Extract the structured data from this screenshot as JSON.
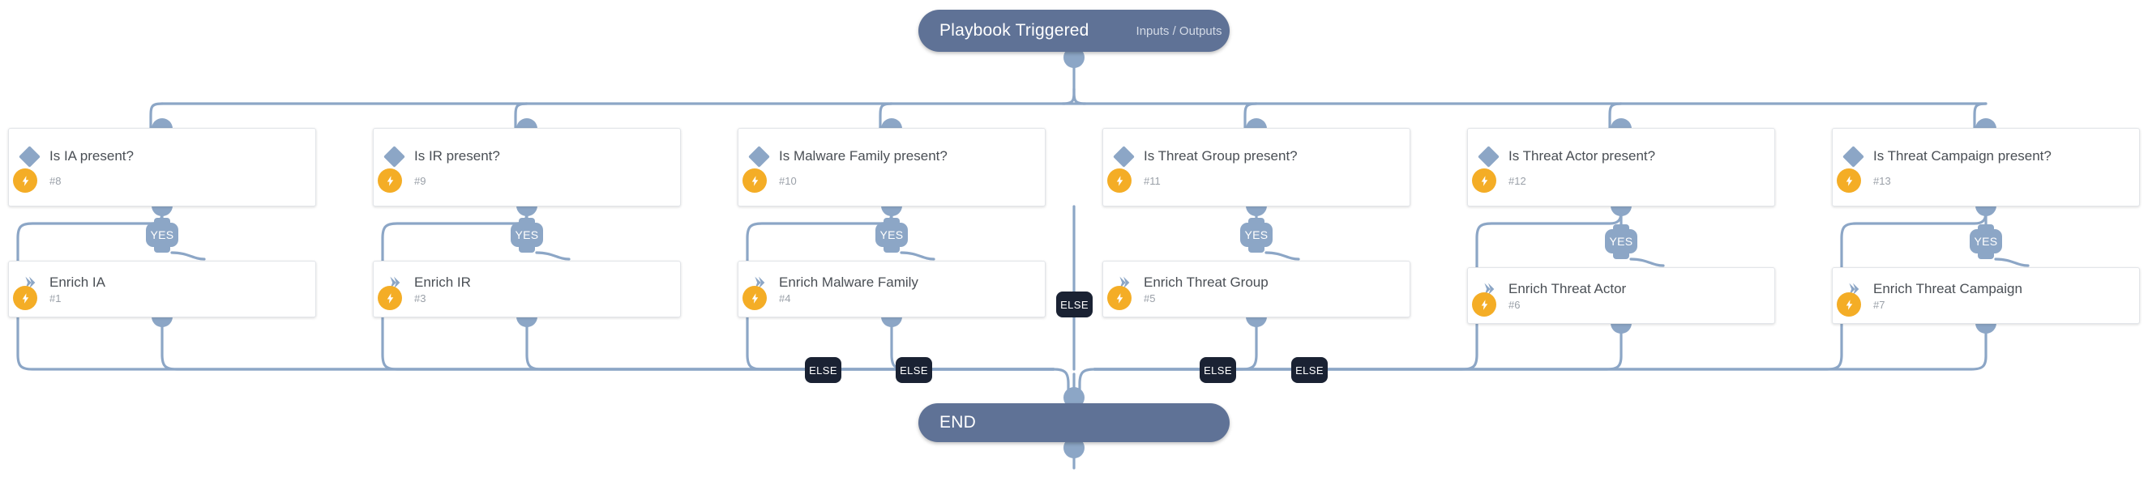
{
  "diagram": {
    "title": "Playbook flow",
    "colors": {
      "node_fill": "#5f7296",
      "card_bg": "#ffffff",
      "connector": "#8ca6c6",
      "bolt": "#f4ad26",
      "else_badge": "#1a2233",
      "text_dark": "#4a4f55",
      "text_muted": "#9aa0a8"
    },
    "start": {
      "label": "Playbook Triggered",
      "sub_label": "Inputs / Outputs"
    },
    "end": {
      "label": "END"
    },
    "branch_labels": {
      "yes": "YES",
      "else": "ELSE"
    },
    "conditions": [
      {
        "label": "Is IA present?",
        "id": "#8",
        "icon": "diamond-icon"
      },
      {
        "label": "Is IR present?",
        "id": "#9",
        "icon": "diamond-icon"
      },
      {
        "label": "Is Malware Family present?",
        "id": "#10",
        "icon": "diamond-icon"
      },
      {
        "label": "Is Threat Group present?",
        "id": "#11",
        "icon": "diamond-icon"
      },
      {
        "label": "Is Threat Actor present?",
        "id": "#12",
        "icon": "diamond-icon"
      },
      {
        "label": "Is Threat Campaign present?",
        "id": "#13",
        "icon": "diamond-icon"
      }
    ],
    "actions": [
      {
        "label": "Enrich IA",
        "id": "#1",
        "icon": "chevron-right-icon"
      },
      {
        "label": "Enrich IR",
        "id": "#3",
        "icon": "chevron-right-icon"
      },
      {
        "label": "Enrich Malware Family",
        "id": "#4",
        "icon": "chevron-right-icon"
      },
      {
        "label": "Enrich Threat Group",
        "id": "#5",
        "icon": "chevron-right-icon"
      },
      {
        "label": "Enrich Threat Actor",
        "id": "#6",
        "icon": "chevron-right-icon"
      },
      {
        "label": "Enrich Threat Campaign",
        "id": "#7",
        "icon": "chevron-right-icon"
      }
    ],
    "yes_badges": [
      "YES",
      "YES",
      "YES",
      "YES",
      "YES",
      "YES"
    ],
    "else_badges": [
      "ELSE",
      "ELSE",
      "ELSE",
      "ELSE",
      "ELSE"
    ]
  }
}
